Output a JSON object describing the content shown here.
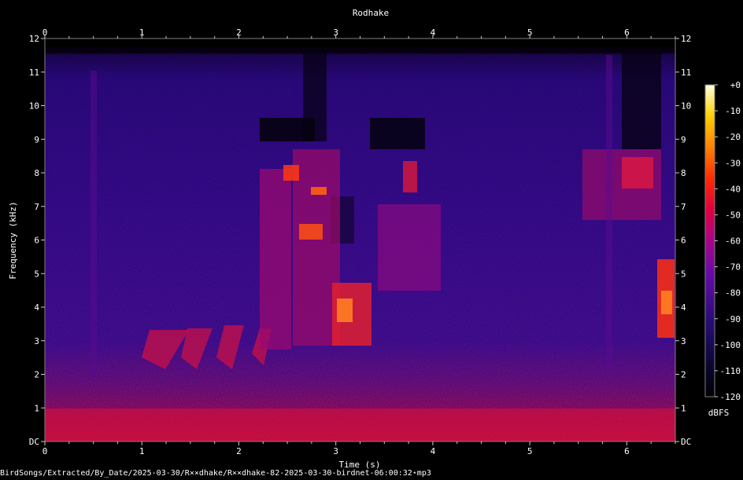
{
  "chart_data": {
    "type": "heatmap",
    "title": "Rodhake",
    "xlabel": "Time (s)",
    "ylabel": "Frequency (kHz)",
    "xlim": [
      0,
      6.5
    ],
    "ylim": [
      0,
      12
    ],
    "x_ticks": [
      "0",
      "1",
      "2",
      "3",
      "4",
      "5",
      "6"
    ],
    "y_ticks": [
      "DC",
      "1",
      "2",
      "3",
      "4",
      "5",
      "6",
      "7",
      "8",
      "9",
      "10",
      "11",
      "12"
    ],
    "colorbar": {
      "label": "dBFS",
      "ticks": [
        "+0",
        "-10",
        "-20",
        "-30",
        "-40",
        "-50",
        "-60",
        "-70",
        "-80",
        "-90",
        "-100",
        "-110",
        "-120"
      ],
      "range": [
        -120,
        0
      ]
    },
    "colors": {
      "background": "#000000",
      "low": "#1a0a5e",
      "mid": "#b0005a",
      "high": "#ff3000",
      "peak": "#ffff99"
    }
  },
  "footer": {
    "path": "BirdSongs/Extracted/By_Date/2025-03-30/R××dhake/R××dhake-82-2025-03-30-birdnet-06:00:32⋆mp3"
  }
}
